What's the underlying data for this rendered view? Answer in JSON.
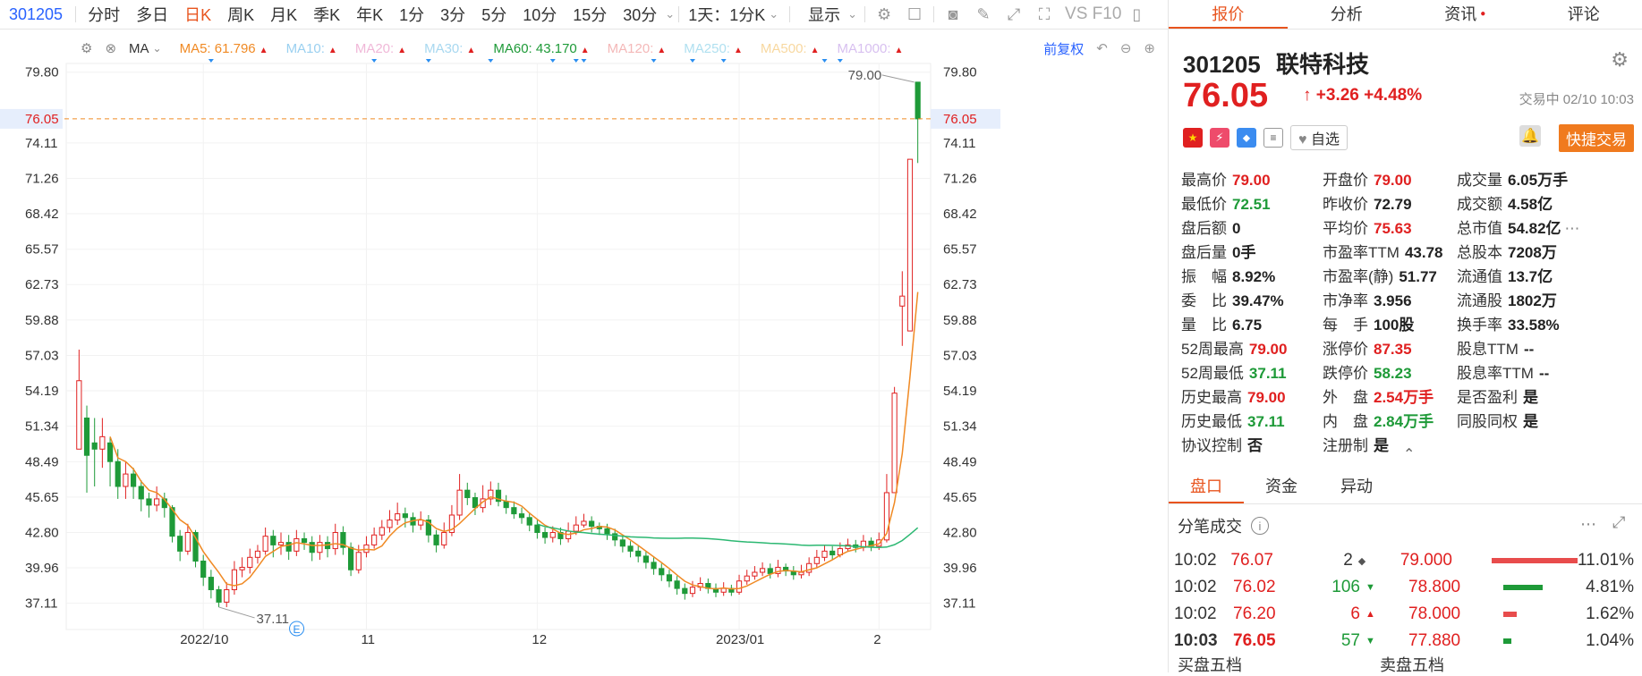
{
  "toolbar": {
    "symbol": "301205",
    "periods": [
      "分时",
      "多日",
      "日K",
      "周K",
      "月K",
      "季K",
      "年K",
      "1分",
      "3分",
      "5分",
      "10分",
      "15分",
      "30分"
    ],
    "active_period": "日K",
    "interval_select": "1天：1分K",
    "display_label": "显示",
    "right_text": "VS F10"
  },
  "ma": {
    "type_label": "MA",
    "items": [
      {
        "label": "MA5: 61.796",
        "color": "#f08a24"
      },
      {
        "label": "MA10:",
        "color": "#9ad0f0"
      },
      {
        "label": "MA20:",
        "color": "#f0b8d8"
      },
      {
        "label": "MA30:",
        "color": "#a8d8f0"
      },
      {
        "label": "MA60: 43.170",
        "color": "#1e9a38"
      },
      {
        "label": "MA120:",
        "color": "#f4b8b8"
      },
      {
        "label": "MA250:",
        "color": "#b0e0f0"
      },
      {
        "label": "MA500:",
        "color": "#f8d8a0"
      },
      {
        "label": "MA1000:",
        "color": "#d8c0f0"
      }
    ],
    "adjust_label": "前复权"
  },
  "chart_data": {
    "type": "candlestick",
    "y_ticks": [
      "79.80",
      "74.11",
      "71.26",
      "68.42",
      "65.57",
      "62.73",
      "59.88",
      "57.03",
      "54.19",
      "51.34",
      "48.49",
      "45.65",
      "42.80",
      "39.96",
      "37.11"
    ],
    "ylim": [
      35.0,
      80.5
    ],
    "x_ticks": [
      "2022/10",
      "11",
      "12",
      "2023/01",
      "2"
    ],
    "current_price": "76.05",
    "high_label": "79.00",
    "low_label": "37.11",
    "colors": {
      "up": "#e02020",
      "down": "#1e9a38",
      "ma5": "#f08a24",
      "ma60": "#2cb872"
    },
    "candles": [
      [
        49.5,
        55.0,
        57.5,
        49.5
      ],
      [
        52.0,
        49.0,
        53.0,
        46.0
      ],
      [
        50.0,
        49.5,
        52.0,
        46.5
      ],
      [
        49.5,
        50.5,
        52.0,
        48.0
      ],
      [
        50.0,
        48.5,
        50.5,
        46.5
      ],
      [
        48.5,
        46.5,
        49.5,
        45.5
      ],
      [
        46.5,
        47.5,
        48.5,
        45.5
      ],
      [
        47.5,
        46.5,
        48.0,
        45.5
      ],
      [
        46.5,
        45.5,
        47.0,
        44.5
      ],
      [
        45.5,
        45.0,
        46.0,
        44.0
      ],
      [
        45.0,
        45.5,
        46.5,
        44.5
      ],
      [
        45.5,
        44.8,
        46.0,
        44.0
      ],
      [
        44.8,
        42.5,
        45.0,
        42.0
      ],
      [
        42.5,
        41.3,
        43.0,
        40.5
      ],
      [
        41.3,
        42.8,
        43.5,
        41.0
      ],
      [
        42.8,
        40.5,
        43.0,
        40.0
      ],
      [
        40.5,
        39.2,
        41.0,
        38.5
      ],
      [
        39.2,
        38.2,
        39.8,
        37.5
      ],
      [
        38.2,
        37.2,
        38.5,
        36.8
      ],
      [
        37.2,
        38.2,
        38.8,
        36.8
      ],
      [
        38.2,
        39.8,
        40.5,
        37.8
      ],
      [
        39.8,
        40.0,
        40.8,
        39.2
      ],
      [
        40.0,
        40.8,
        41.5,
        39.5
      ],
      [
        40.8,
        41.3,
        41.8,
        40.3
      ],
      [
        41.3,
        42.5,
        43.2,
        41.0
      ],
      [
        42.5,
        41.8,
        43.0,
        40.8
      ],
      [
        41.8,
        42.0,
        42.8,
        41.0
      ],
      [
        42.0,
        41.3,
        42.6,
        40.6
      ],
      [
        41.3,
        42.3,
        43.0,
        40.9
      ],
      [
        42.3,
        42.0,
        42.8,
        41.4
      ],
      [
        42.0,
        41.2,
        42.5,
        40.5
      ],
      [
        41.2,
        42.0,
        42.6,
        40.6
      ],
      [
        42.0,
        41.5,
        42.5,
        40.8
      ],
      [
        41.5,
        42.8,
        43.5,
        41.0
      ],
      [
        42.8,
        41.6,
        43.3,
        41.0
      ],
      [
        41.6,
        39.8,
        42.0,
        39.3
      ],
      [
        39.8,
        41.2,
        41.8,
        39.5
      ],
      [
        41.2,
        41.8,
        42.5,
        40.8
      ],
      [
        41.8,
        42.6,
        43.2,
        41.5
      ],
      [
        42.6,
        43.2,
        43.8,
        42.2
      ],
      [
        43.2,
        43.8,
        44.6,
        42.8
      ],
      [
        43.8,
        44.3,
        45.2,
        43.4
      ],
      [
        44.3,
        44.0,
        44.8,
        43.2
      ],
      [
        44.0,
        43.4,
        44.4,
        42.8
      ],
      [
        43.4,
        43.8,
        44.5,
        43.0
      ],
      [
        43.8,
        42.6,
        44.2,
        42.0
      ],
      [
        42.6,
        41.8,
        43.0,
        41.2
      ],
      [
        41.8,
        42.8,
        43.6,
        41.5
      ],
      [
        42.8,
        44.2,
        45.0,
        42.5
      ],
      [
        44.2,
        46.2,
        47.5,
        43.8
      ],
      [
        46.2,
        45.6,
        46.8,
        45.0
      ],
      [
        45.6,
        44.8,
        46.0,
        44.2
      ],
      [
        44.8,
        45.5,
        46.6,
        44.4
      ],
      [
        45.5,
        46.2,
        46.9,
        45.0
      ],
      [
        46.2,
        45.3,
        46.8,
        44.9
      ],
      [
        45.3,
        44.8,
        45.8,
        44.3
      ],
      [
        44.8,
        44.3,
        45.3,
        43.9
      ],
      [
        44.3,
        44.0,
        44.8,
        43.5
      ],
      [
        44.0,
        43.4,
        44.4,
        42.9
      ],
      [
        43.4,
        42.8,
        43.8,
        42.3
      ],
      [
        42.8,
        42.4,
        43.2,
        41.9
      ],
      [
        42.4,
        42.8,
        43.3,
        42.0
      ],
      [
        42.8,
        42.3,
        43.2,
        41.8
      ],
      [
        42.3,
        42.9,
        43.6,
        42.0
      ],
      [
        42.9,
        43.4,
        44.1,
        42.6
      ],
      [
        43.4,
        43.7,
        44.3,
        43.2
      ],
      [
        43.7,
        43.3,
        44.1,
        42.8
      ],
      [
        43.3,
        43.1,
        43.6,
        42.6
      ],
      [
        43.1,
        42.7,
        43.5,
        42.2
      ],
      [
        42.7,
        42.2,
        43.1,
        41.7
      ],
      [
        42.2,
        41.7,
        42.6,
        41.2
      ],
      [
        41.7,
        41.3,
        42.1,
        40.8
      ],
      [
        41.3,
        40.9,
        41.7,
        40.4
      ],
      [
        40.9,
        40.4,
        41.3,
        39.9
      ],
      [
        40.4,
        39.9,
        40.8,
        39.4
      ],
      [
        39.9,
        39.4,
        40.3,
        38.9
      ],
      [
        39.4,
        38.9,
        39.8,
        38.4
      ],
      [
        38.9,
        38.3,
        39.3,
        37.8
      ],
      [
        38.3,
        37.9,
        38.7,
        37.4
      ],
      [
        37.9,
        38.4,
        38.9,
        37.6
      ],
      [
        38.4,
        38.7,
        39.2,
        38.1
      ],
      [
        38.7,
        38.3,
        39.1,
        37.9
      ],
      [
        38.3,
        38.0,
        38.7,
        37.6
      ],
      [
        38.0,
        38.3,
        38.8,
        37.7
      ],
      [
        38.3,
        38.0,
        38.6,
        37.7
      ],
      [
        38.0,
        38.9,
        39.4,
        37.8
      ],
      [
        38.9,
        39.3,
        39.8,
        38.6
      ],
      [
        39.3,
        39.6,
        40.1,
        39.0
      ],
      [
        39.6,
        39.9,
        40.4,
        39.3
      ],
      [
        39.9,
        39.5,
        40.3,
        39.1
      ],
      [
        39.5,
        40.0,
        40.6,
        39.2
      ],
      [
        40.0,
        39.7,
        40.3,
        39.3
      ],
      [
        39.7,
        39.4,
        40.1,
        39.0
      ],
      [
        39.4,
        39.6,
        40.2,
        39.1
      ],
      [
        39.6,
        40.3,
        40.8,
        39.3
      ],
      [
        40.3,
        40.8,
        41.4,
        40.0
      ],
      [
        40.8,
        41.3,
        41.8,
        40.5
      ],
      [
        41.3,
        41.0,
        41.7,
        40.6
      ],
      [
        41.0,
        41.5,
        42.0,
        40.8
      ],
      [
        41.5,
        41.8,
        42.3,
        41.3
      ],
      [
        41.8,
        41.6,
        42.2,
        41.2
      ],
      [
        41.6,
        42.1,
        42.6,
        41.3
      ],
      [
        42.1,
        41.7,
        42.4,
        41.3
      ],
      [
        41.7,
        42.2,
        42.8,
        41.4
      ],
      [
        42.2,
        46.0,
        47.5,
        42.0
      ],
      [
        46.0,
        54.0,
        54.5,
        46.0
      ],
      [
        61.0,
        61.8,
        63.8,
        57.8
      ],
      [
        59.0,
        72.8,
        72.8,
        59.0
      ],
      [
        79.0,
        76.05,
        79.0,
        72.5
      ]
    ]
  },
  "panel": {
    "tabs": [
      "报价",
      "分析",
      "资讯",
      "评论"
    ],
    "active_tab": "报价",
    "code": "301205",
    "name": "联特科技",
    "price": "76.05",
    "change": "↑ +3.26  +4.48%",
    "status": "交易中 02/10 10:03",
    "watch_label": "自选",
    "trade_label": "快捷交易",
    "quote": [
      [
        {
          "l": "最高价",
          "v": "79.00",
          "c": "red"
        },
        {
          "l": "开盘价",
          "v": "79.00",
          "c": "red"
        },
        {
          "l": "成交量",
          "v": "6.05万手",
          "c": "blk"
        }
      ],
      [
        {
          "l": "最低价",
          "v": "72.51",
          "c": "green"
        },
        {
          "l": "昨收价",
          "v": "72.79",
          "c": "blk"
        },
        {
          "l": "成交额",
          "v": "4.58亿",
          "c": "blk"
        }
      ],
      [
        {
          "l": "盘后额",
          "v": "0",
          "c": "blk"
        },
        {
          "l": "平均价",
          "v": "75.63",
          "c": "red"
        },
        {
          "l": "总市值",
          "v": "54.82亿",
          "c": "blk"
        }
      ],
      [
        {
          "l": "盘后量",
          "v": "0手",
          "c": "blk"
        },
        {
          "l": "市盈率TTM",
          "v": "43.78",
          "c": "blk"
        },
        {
          "l": "总股本",
          "v": "7208万",
          "c": "blk"
        }
      ],
      [
        {
          "l": "振　幅",
          "v": "8.92%",
          "c": "blk"
        },
        {
          "l": "市盈率(静)",
          "v": "51.77",
          "c": "blk"
        },
        {
          "l": "流通值",
          "v": "13.7亿",
          "c": "blk"
        }
      ],
      [
        {
          "l": "委　比",
          "v": "39.47%",
          "c": "blk"
        },
        {
          "l": "市净率",
          "v": "3.956",
          "c": "blk"
        },
        {
          "l": "流通股",
          "v": "1802万",
          "c": "blk"
        }
      ],
      [
        {
          "l": "量　比",
          "v": "6.75",
          "c": "blk"
        },
        {
          "l": "每　手",
          "v": "100股",
          "c": "blk"
        },
        {
          "l": "换手率",
          "v": "33.58%",
          "c": "blk"
        }
      ],
      [
        {
          "l": "52周最高",
          "v": "79.00",
          "c": "red"
        },
        {
          "l": "涨停价",
          "v": "87.35",
          "c": "red"
        },
        {
          "l": "股息TTM",
          "v": "--",
          "c": "blk"
        }
      ],
      [
        {
          "l": "52周最低",
          "v": "37.11",
          "c": "green"
        },
        {
          "l": "跌停价",
          "v": "58.23",
          "c": "green"
        },
        {
          "l": "股息率TTM",
          "v": "--",
          "c": "blk"
        }
      ],
      [
        {
          "l": "历史最高",
          "v": "79.00",
          "c": "red"
        },
        {
          "l": "外　盘",
          "v": "2.54万手",
          "c": "red"
        },
        {
          "l": "是否盈利",
          "v": "是",
          "c": "blk"
        }
      ],
      [
        {
          "l": "历史最低",
          "v": "37.11",
          "c": "green"
        },
        {
          "l": "内　盘",
          "v": "2.84万手",
          "c": "green"
        },
        {
          "l": "同股同权",
          "v": "是",
          "c": "blk"
        }
      ],
      [
        {
          "l": "协议控制",
          "v": "否",
          "c": "blk"
        },
        {
          "l": "注册制",
          "v": "是",
          "c": "blk"
        },
        {
          "l": "",
          "v": "",
          "c": "blk"
        }
      ]
    ],
    "subtabs": [
      "盘口",
      "资金",
      "异动"
    ],
    "active_subtab": "盘口",
    "ticks_title": "分笔成交",
    "ticks": [
      {
        "t": "10:02",
        "p": "76.07",
        "v": "2",
        "dir": "flat"
      },
      {
        "t": "10:02",
        "p": "76.02",
        "v": "106",
        "dir": "down"
      },
      {
        "t": "10:02",
        "p": "76.20",
        "v": "6",
        "dir": "up"
      },
      {
        "t": "10:03",
        "p": "76.05",
        "v": "57",
        "dir": "down"
      }
    ],
    "levels": [
      {
        "p": "79.000",
        "pct": "11.01%",
        "c": "red"
      },
      {
        "p": "78.800",
        "pct": "4.81%",
        "c": "green"
      },
      {
        "p": "78.000",
        "pct": "1.62%",
        "c": "red"
      },
      {
        "p": "77.880",
        "pct": "1.04%",
        "c": "green"
      }
    ],
    "bottom_buy": "买盘五档",
    "bottom_sell": "卖盘五档"
  }
}
